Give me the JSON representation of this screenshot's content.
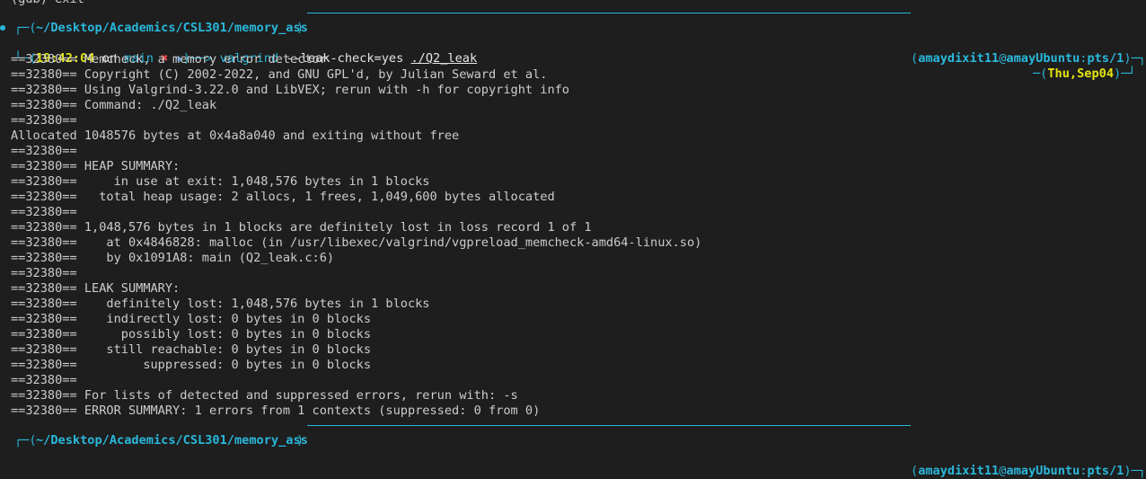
{
  "prev_line": "(gdb) exit",
  "prompt": {
    "path": "~/Desktop/Academics/CSL301/memory_ass",
    "user": "amaydixit11",
    "host": "amayUbuntu",
    "tty": "pts/1",
    "time": "19:42:04",
    "on_word": "on",
    "branch": "main",
    "dirty_mark": "✖",
    "star_mark": "★",
    "arrow": "──>",
    "command": "valgrind",
    "command_args": "--leak-check=yes",
    "command_target": "./Q2_leak",
    "date": "Thu,Sep04"
  },
  "output_lines": [
    "==32380== Memcheck, a memory error detector",
    "==32380== Copyright (C) 2002-2022, and GNU GPL'd, by Julian Seward et al.",
    "==32380== Using Valgrind-3.22.0 and LibVEX; rerun with -h for copyright info",
    "==32380== Command: ./Q2_leak",
    "==32380==",
    "Allocated 1048576 bytes at 0x4a8a040 and exiting without free",
    "==32380==",
    "==32380== HEAP SUMMARY:",
    "==32380==     in use at exit: 1,048,576 bytes in 1 blocks",
    "==32380==   total heap usage: 2 allocs, 1 frees, 1,049,600 bytes allocated",
    "==32380==",
    "==32380== 1,048,576 bytes in 1 blocks are definitely lost in loss record 1 of 1",
    "==32380==    at 0x4846828: malloc (in /usr/libexec/valgrind/vgpreload_memcheck-amd64-linux.so)",
    "==32380==    by 0x1091A8: main (Q2_leak.c:6)",
    "==32380==",
    "==32380== LEAK SUMMARY:",
    "==32380==    definitely lost: 1,048,576 bytes in 1 blocks",
    "==32380==    indirectly lost: 0 bytes in 0 blocks",
    "==32380==      possibly lost: 0 bytes in 0 blocks",
    "==32380==    still reachable: 0 bytes in 0 blocks",
    "==32380==         suppressed: 0 bytes in 0 blocks",
    "==32380==",
    "==32380== For lists of detected and suppressed errors, rerun with: -s",
    "==32380== ERROR SUMMARY: 1 errors from 1 contexts (suppressed: 0 from 0)"
  ],
  "colors": {
    "background": "#1e1e1e",
    "foreground": "#cccccc",
    "accent_cyan": "#29b8db",
    "yellow": "#e5e510",
    "red": "#f14c4c"
  }
}
